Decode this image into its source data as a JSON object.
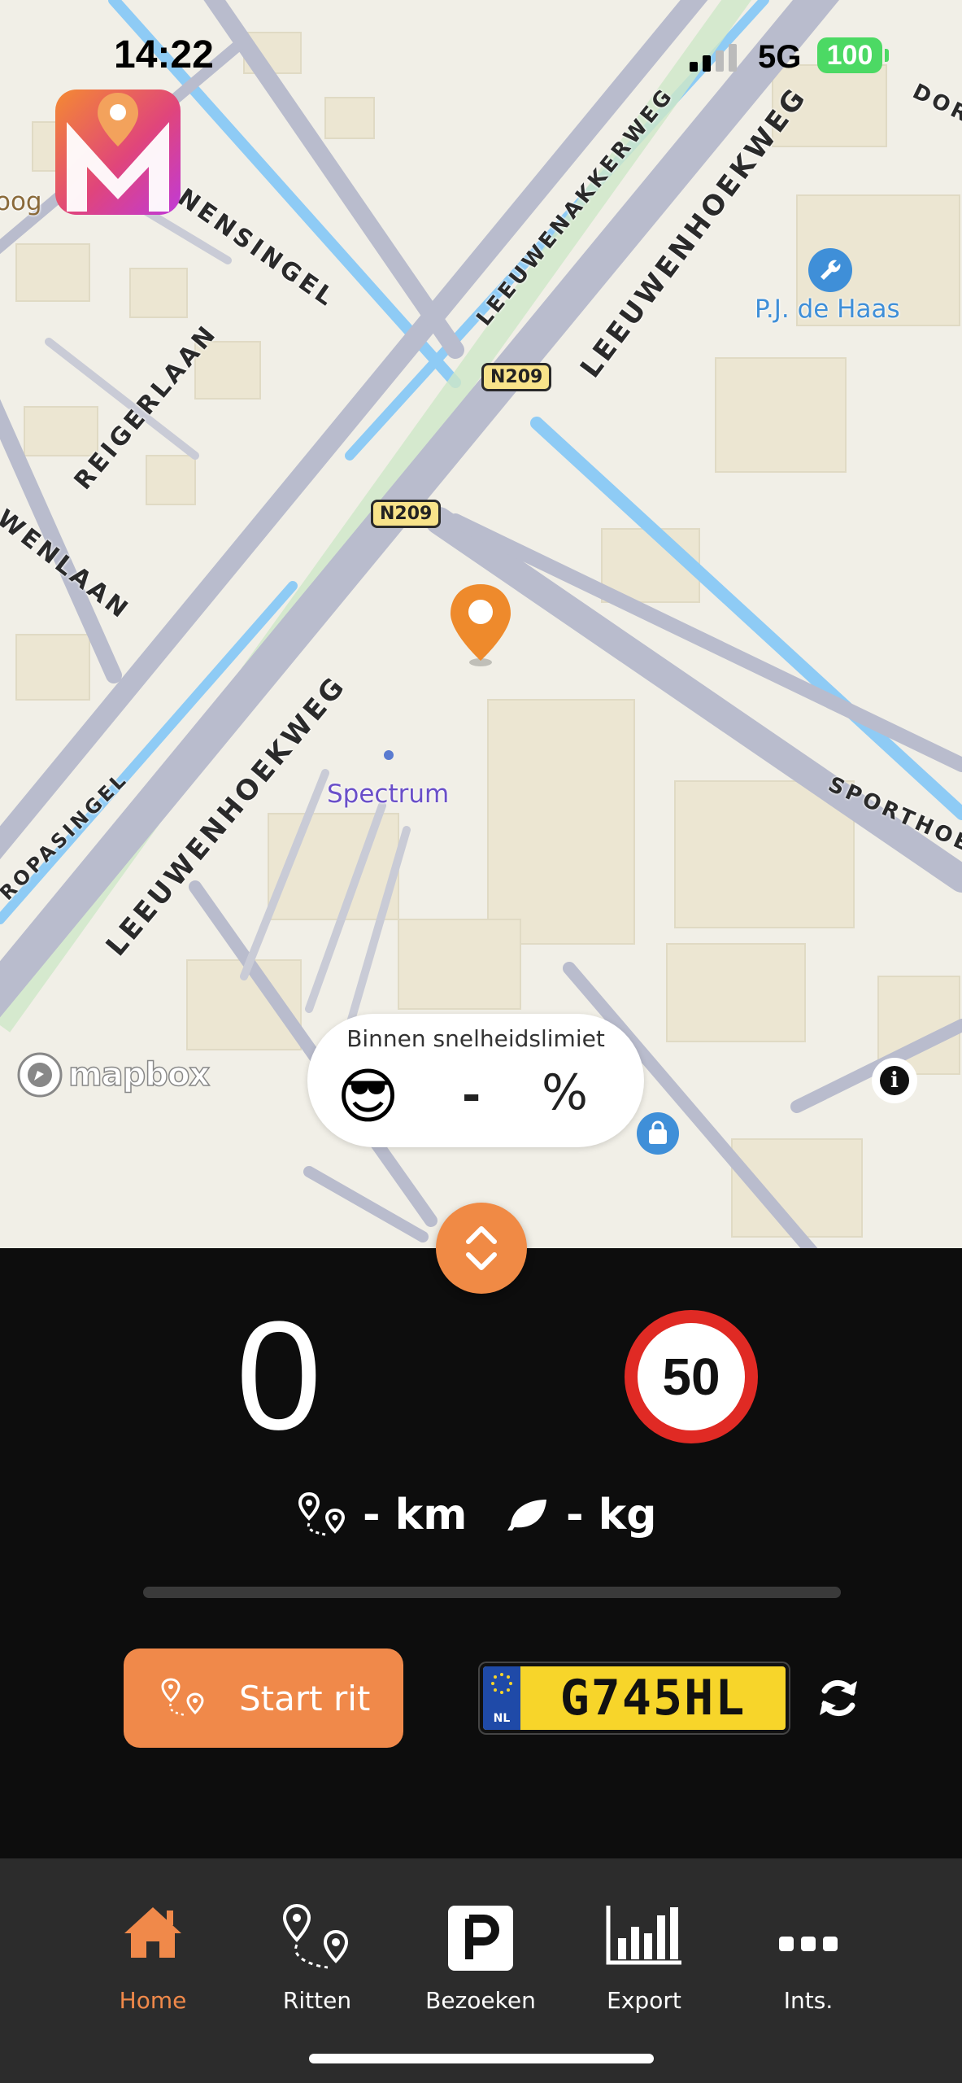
{
  "status_bar": {
    "time": "14:22",
    "network": "5G",
    "battery": "100"
  },
  "map": {
    "road_labels": [
      "LEEUWENAKKERWEG",
      "LEEUWENHOEKWEG",
      "LEEUWENHOEKWEG",
      "NENSINGEL",
      "REIGERLAAN",
      "WENLAAN",
      "ROPASINGEL",
      "SPORTHOE",
      "DOR"
    ],
    "shields": [
      "N209",
      "N209"
    ],
    "pois": [
      {
        "name": "P.J. de Haas",
        "icon": "wrench-icon",
        "color": "#3f8fd8"
      },
      {
        "name": "Spectrum",
        "icon": "dot-icon",
        "color": "#6a4fc9"
      }
    ],
    "left_edge_label": "oog",
    "attribution": "mapbox"
  },
  "speed_popup": {
    "title": "Binnen snelheidslimiet",
    "emoji": "😎",
    "value": "-",
    "unit": "%"
  },
  "dashboard": {
    "speed": "0",
    "speed_limit": "50",
    "distance": "- km",
    "co2": "- kg",
    "progress": 0,
    "start_button": "Start rit",
    "license_plate": "G745HL",
    "plate_country": "NL"
  },
  "tabs": [
    {
      "label": "Home",
      "icon": "home-icon",
      "active": true
    },
    {
      "label": "Ritten",
      "icon": "route-icon",
      "active": false
    },
    {
      "label": "Bezoeken",
      "icon": "parking-icon",
      "active": false
    },
    {
      "label": "Export",
      "icon": "bar-chart-icon",
      "active": false
    },
    {
      "label": "Ints.",
      "icon": "more-icon",
      "active": false
    }
  ],
  "colors": {
    "accent": "#f0894a",
    "speed_limit_ring": "#e02a24",
    "plate_yellow": "#f7d52a",
    "water": "#8ecbf5"
  }
}
